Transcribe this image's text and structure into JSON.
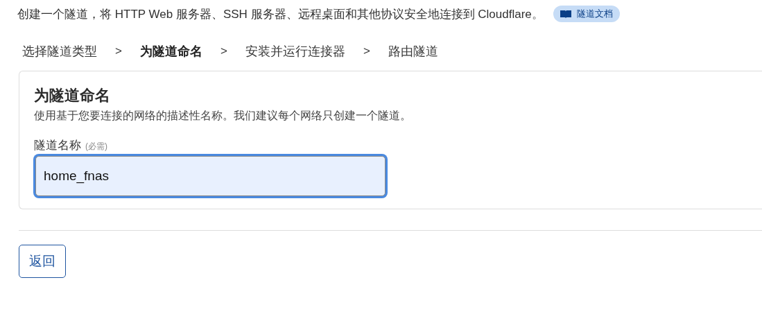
{
  "intro": {
    "text": "创建一个隧道，将 HTTP Web 服务器、SSH 服务器、远程桌面和其他协议安全地连接到 Cloudflare。",
    "doc_link": "隧道文档"
  },
  "breadcrumb": [
    {
      "kind": "step",
      "label": "选择隧道类型",
      "selected": false
    },
    {
      "kind": "separator",
      "label": ">"
    },
    {
      "kind": "step",
      "label": "为隧道命名",
      "selected": true
    },
    {
      "kind": "separator",
      "label": ">"
    },
    {
      "kind": "step",
      "label": "安装并运行连接器",
      "selected": false
    },
    {
      "kind": "separator",
      "label": ">"
    },
    {
      "kind": "step",
      "label": "路由隧道",
      "selected": false
    }
  ],
  "card": {
    "title": "为隧道命名",
    "description": "使用基于您要连接的网络的描述性名称。我们建议每个网络只创建一个隧道。",
    "field": {
      "label": "隧道名称",
      "required_note": "(必需)",
      "value": "home_fnas",
      "focused": true
    }
  },
  "buttons": [
    {
      "label": "返回"
    }
  ]
}
